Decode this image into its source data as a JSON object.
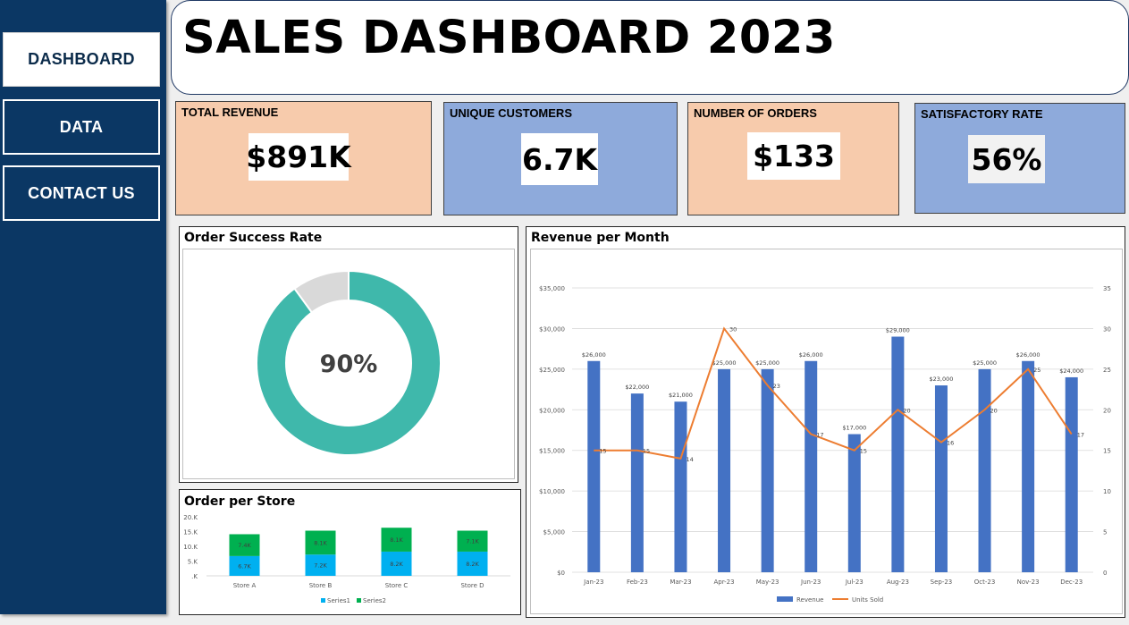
{
  "sidebar": {
    "items": [
      {
        "label": "DASHBOARD",
        "active": true
      },
      {
        "label": "DATA",
        "active": false
      },
      {
        "label": "CONTACT US",
        "active": false
      }
    ]
  },
  "header": {
    "title": "SALES DASHBOARD 2023"
  },
  "kpis": [
    {
      "label": "TOTAL REVENUE",
      "value": "$891K",
      "color": "#f7cbac"
    },
    {
      "label": "UNIQUE CUSTOMERS",
      "value": "6.7K",
      "color": "#8eaadb"
    },
    {
      "label": "NUMBER OF ORDERS",
      "value": "$133",
      "color": "#f7cbac"
    },
    {
      "label": "SATISFACTORY RATE",
      "value": "56%",
      "color": "#8eaadb"
    }
  ],
  "panels": {
    "success_title": "Order Success Rate",
    "store_title": "Order per Store",
    "revenue_title": "Revenue per Month"
  },
  "chart_data": [
    {
      "type": "pie",
      "variant": "donut",
      "center_label": "90%",
      "slices": [
        {
          "value": 90,
          "color": "#3fb8ab"
        },
        {
          "value": 10,
          "color": "#d9d9d9"
        }
      ]
    },
    {
      "type": "bar",
      "stacked": true,
      "categories": [
        "Store A",
        "Store B",
        "Store C",
        "Store D"
      ],
      "y_ticks": [
        "20.K",
        "15.K",
        "10.K",
        "5.K",
        ".K"
      ],
      "ylim": [
        0,
        20000
      ],
      "series": [
        {
          "name": "Series1",
          "color": "#00b0f0",
          "values": [
            6700,
            7200,
            8200,
            8200
          ],
          "labels": [
            "6.7K",
            "7.2K",
            "8.2K",
            "8.2K"
          ]
        },
        {
          "name": "Series2",
          "color": "#00b050",
          "values": [
            7400,
            8100,
            8100,
            7100
          ],
          "labels": [
            "7.4K",
            "8.1K",
            "8.1K",
            "7.1K"
          ]
        }
      ],
      "legend": "bottom"
    },
    {
      "type": "bar",
      "combo": "bar+line",
      "categories": [
        "Jan-23",
        "Feb-23",
        "Mar-23",
        "Apr-23",
        "May-23",
        "Jun-23",
        "Jul-23",
        "Aug-23",
        "Sep-23",
        "Oct-23",
        "Nov-23",
        "Dec-23"
      ],
      "series": [
        {
          "name": "Revenue",
          "type": "bar",
          "axis": "left",
          "color": "#4472c4",
          "values": [
            26000,
            22000,
            21000,
            25000,
            25000,
            26000,
            17000,
            29000,
            23000,
            25000,
            26000,
            24000
          ],
          "labels": [
            "$26,000",
            "$22,000",
            "$21,000",
            "$25,000",
            "$25,000",
            "$26,000",
            "$17,000",
            "$29,000",
            "$23,000",
            "$25,000",
            "$26,000",
            "$24,000"
          ]
        },
        {
          "name": "Units Sold",
          "type": "line",
          "axis": "right",
          "color": "#ed7d31",
          "values": [
            15,
            15,
            14,
            30,
            23,
            17,
            15,
            20,
            16,
            20,
            25,
            17
          ],
          "labels": [
            "15",
            "15",
            "14",
            "30",
            "23",
            "17",
            "15",
            "20",
            "16",
            "20",
            "25",
            "17"
          ]
        }
      ],
      "left_ticks": [
        "$35,000",
        "$30,000",
        "$25,000",
        "$20,000",
        "$15,000",
        "$10,000",
        "$5,000",
        "$0"
      ],
      "right_ticks": [
        "35",
        "30",
        "25",
        "20",
        "15",
        "10",
        "5",
        "0"
      ],
      "ylim_left": [
        0,
        35000
      ],
      "ylim_right": [
        0,
        35
      ],
      "grid": true,
      "legend": "bottom"
    }
  ]
}
